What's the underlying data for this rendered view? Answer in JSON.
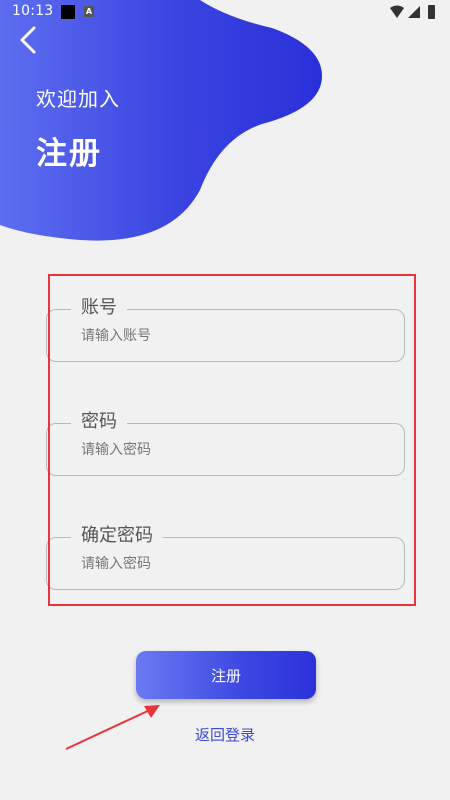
{
  "status_bar": {
    "time": "10:13"
  },
  "header": {
    "welcome": "欢迎加入",
    "title": "注册"
  },
  "form": {
    "fields": [
      {
        "label": "账号",
        "placeholder": "请输入账号"
      },
      {
        "label": "密码",
        "placeholder": "请输入密码"
      },
      {
        "label": "确定密码",
        "placeholder": "请输入密码"
      }
    ]
  },
  "actions": {
    "register_label": "注册",
    "back_to_login": "返回登录"
  },
  "colors": {
    "gradient_start": "#6b7af2",
    "gradient_end": "#2b31d9",
    "link": "#3b4bd8",
    "highlight": "#e8353a"
  }
}
